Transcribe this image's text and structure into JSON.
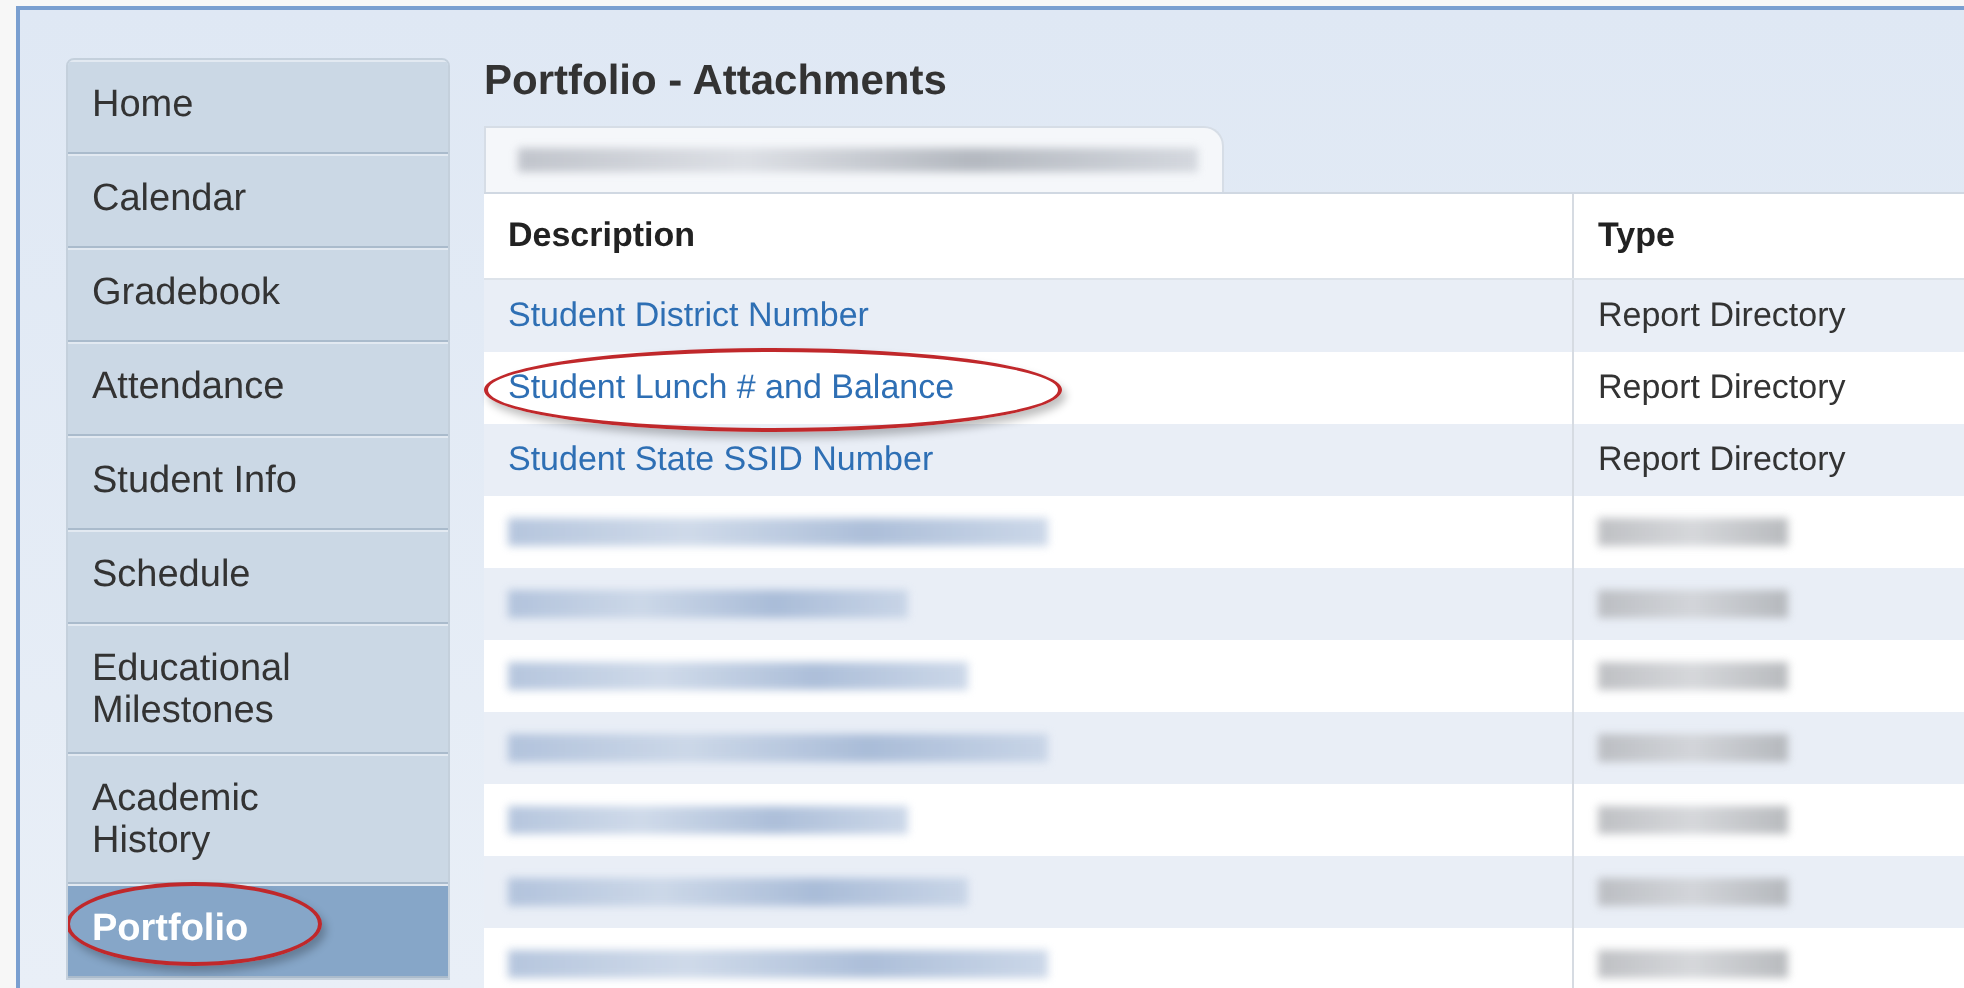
{
  "sidebar": {
    "items": [
      {
        "label": "Home",
        "selected": false,
        "circled": false
      },
      {
        "label": "Calendar",
        "selected": false,
        "circled": false
      },
      {
        "label": "Gradebook",
        "selected": false,
        "circled": false
      },
      {
        "label": "Attendance",
        "selected": false,
        "circled": false
      },
      {
        "label": "Student Info",
        "selected": false,
        "circled": false
      },
      {
        "label": "Schedule",
        "selected": false,
        "circled": false
      },
      {
        "label": "Educational Milestones",
        "selected": false,
        "circled": false
      },
      {
        "label": "Academic History",
        "selected": false,
        "circled": false
      },
      {
        "label": "Portfolio",
        "selected": true,
        "circled": true
      }
    ]
  },
  "page_title": "Portfolio - Attachments",
  "tabs": [
    {
      "kind": "blurred",
      "selected": true
    }
  ],
  "table": {
    "columns": [
      "Description",
      "Type"
    ],
    "rows": [
      {
        "kind": "entry",
        "description": "Student District Number",
        "type": "Report Directory",
        "circled": false
      },
      {
        "kind": "entry",
        "description": "Student Lunch # and Balance",
        "type": "Report Directory",
        "circled": true
      },
      {
        "kind": "entry",
        "description": "Student State SSID Number",
        "type": "Report Directory",
        "circled": false
      },
      {
        "kind": "blurred"
      },
      {
        "kind": "blurred"
      },
      {
        "kind": "blurred"
      },
      {
        "kind": "blurred"
      },
      {
        "kind": "blurred"
      },
      {
        "kind": "blurred"
      },
      {
        "kind": "blurred"
      }
    ]
  }
}
